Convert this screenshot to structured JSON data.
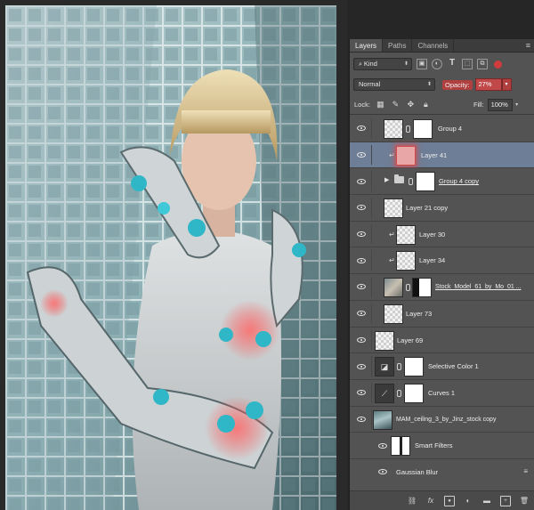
{
  "panel": {
    "tabs": [
      {
        "label": "Layers"
      },
      {
        "label": "Paths"
      },
      {
        "label": "Channels"
      }
    ],
    "menu_icon": "panel-menu-icon"
  },
  "filter": {
    "kind_label": "Kind",
    "icons": [
      "pixel-filter-icon",
      "adjustment-filter-icon",
      "type-filter-icon",
      "shape-filter-icon",
      "smart-object-filter-icon",
      "filter-toggle-icon"
    ],
    "type_glyph": "T"
  },
  "blend": {
    "mode": "Normal",
    "opacity_label": "Opacity:",
    "opacity_value": "27%"
  },
  "lock": {
    "label": "Lock:",
    "icons": [
      "lock-transparent-icon",
      "lock-paint-icon",
      "lock-move-icon",
      "lock-all-icon"
    ],
    "fill_label": "Fill:",
    "fill_value": "100%"
  },
  "layers": [
    {
      "name": "Group 4",
      "thumb": "trans",
      "mask": "mask-shape"
    },
    {
      "name": "Layer 41",
      "thumb": "red",
      "selected": true,
      "clipped": true
    },
    {
      "name": "Group 4 copy",
      "group": true,
      "mask": "mask-shape",
      "underline": true
    },
    {
      "name": "Layer 21 copy",
      "thumb": "trans"
    },
    {
      "name": "Layer 30",
      "thumb": "trans",
      "clipped": true
    },
    {
      "name": "Layer 34",
      "thumb": "trans",
      "clipped": true
    },
    {
      "name": "Stock_Model_61_by_Mo_01 ...",
      "thumb": "photo",
      "mask": "mask-shape",
      "underline": true
    },
    {
      "name": "Layer 73",
      "thumb": "trans"
    },
    {
      "name": "Layer 69",
      "thumb": "trans",
      "no_indent": true
    },
    {
      "name": "Selective Color 1",
      "adjustment": "selective-color-icon",
      "mask": "white"
    },
    {
      "name": "Curves 1",
      "adjustment": "curves-icon",
      "mask": "white"
    },
    {
      "name": "MAM_ceiling_3_by_Jinz_stock copy",
      "thumb": "ceiling",
      "no_indent": true
    },
    {
      "name": "Smart Filters",
      "thumb": "white",
      "sub": true
    },
    {
      "name": "Gaussian Blur",
      "sub": true,
      "filter": true
    }
  ],
  "bottom_toolbar": [
    "link-layers-icon",
    "add-style-icon",
    "add-mask-icon",
    "new-adjustment-icon",
    "new-group-icon",
    "new-layer-icon",
    "delete-layer-icon"
  ],
  "bottom_glyphs": {
    "fx": "fx"
  }
}
